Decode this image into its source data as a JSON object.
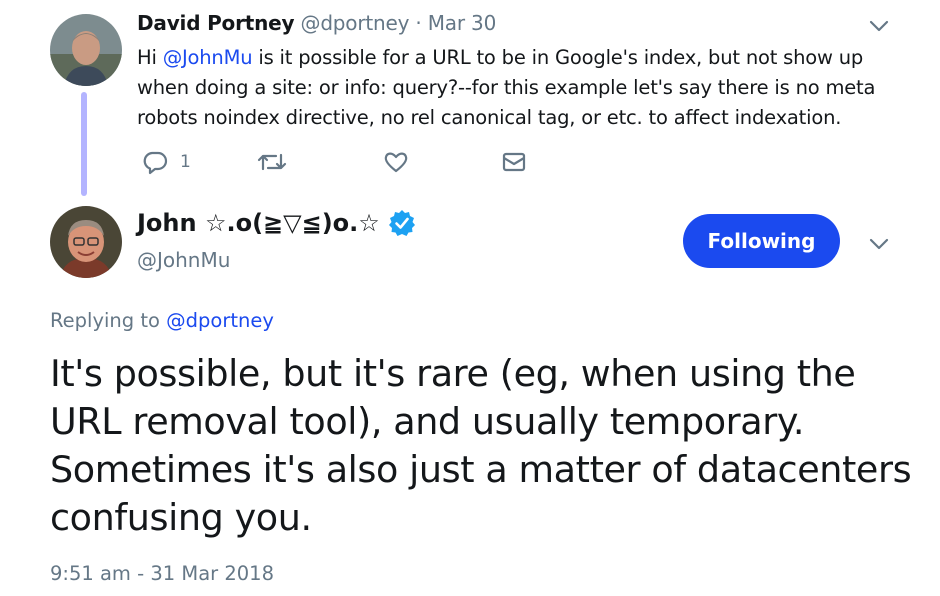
{
  "parent_tweet": {
    "name": "David Portney",
    "handle": "@dportney",
    "separator": "·",
    "date": "Mar 30",
    "text_before": "Hi ",
    "mention": "@JohnMu",
    "text_after": " is it possible for a URL to be in Google's index, but not show up when doing a site: or info: query?--for this example let's say there is no meta robots noindex directive, no rel canonical tag, or etc. to affect indexation.",
    "reply_count": "1",
    "icons": [
      "reply-icon",
      "retweet-icon",
      "like-icon",
      "direct-message-icon",
      "chevron-down-icon"
    ]
  },
  "main_tweet": {
    "name": "John ☆.o(≧▽≦)o.☆",
    "handle": "@JohnMu",
    "follow_label": "Following",
    "replying_prefix": "Replying to ",
    "replying_to": "@dportney",
    "text": "It's possible, but it's rare (eg, when using the URL removal tool), and usually temporary. Sometimes it's also just a matter of datacenters confusing you.",
    "timestamp": "9:51 am - 31 Mar 2018",
    "icons": [
      "verified-badge-icon",
      "chevron-down-icon"
    ]
  },
  "colors": {
    "accent": "#1b4aef",
    "muted": "#657786",
    "verified": "#1da1f2",
    "thread_line": "#b3b4ff"
  }
}
